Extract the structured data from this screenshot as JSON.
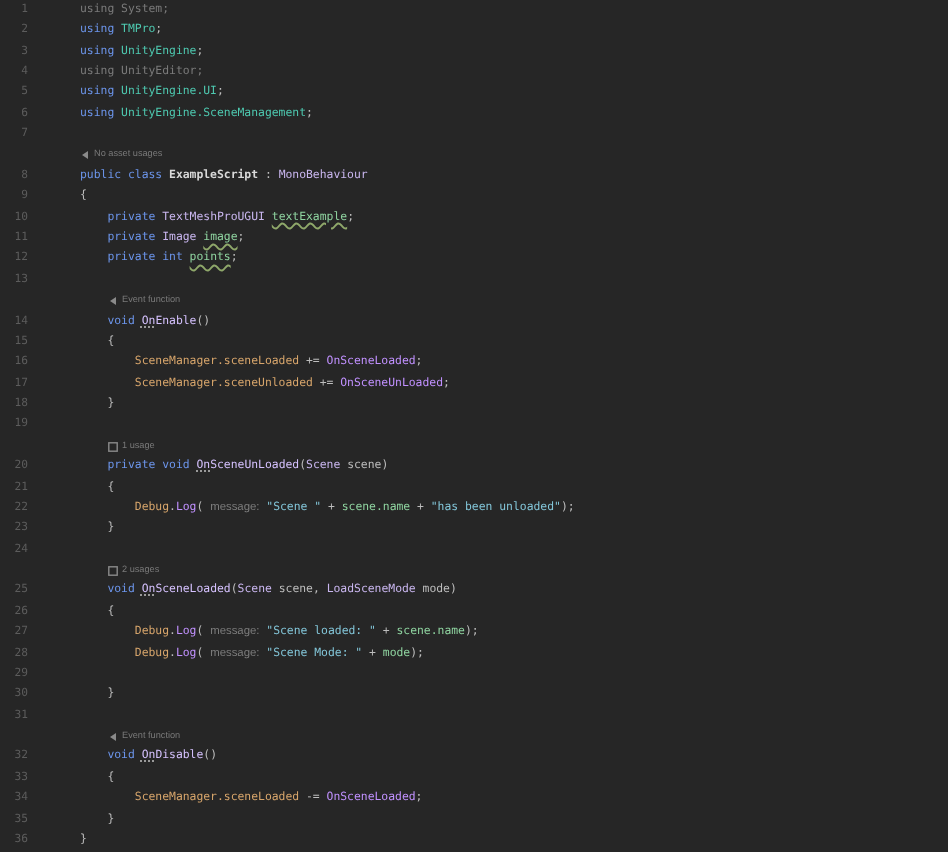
{
  "editor": {
    "lines": [
      {
        "kind": "code",
        "number": "1",
        "tokens": [
          {
            "text": "using System;",
            "kind": "dim"
          }
        ]
      },
      {
        "kind": "code",
        "number": "2",
        "tokens": [
          {
            "text": "using ",
            "kind": "kw"
          },
          {
            "text": "TMPro",
            "kind": "ns"
          },
          {
            "text": ";",
            "kind": "plain"
          }
        ]
      },
      {
        "kind": "code",
        "number": "3",
        "tokens": [
          {
            "text": "using ",
            "kind": "kw"
          },
          {
            "text": "UnityEngine",
            "kind": "ns"
          },
          {
            "text": ";",
            "kind": "plain"
          }
        ]
      },
      {
        "kind": "code",
        "number": "4",
        "tokens": [
          {
            "text": "using UnityEditor;",
            "kind": "dim"
          }
        ]
      },
      {
        "kind": "code",
        "number": "5",
        "tokens": [
          {
            "text": "using ",
            "kind": "kw"
          },
          {
            "text": "UnityEngine.UI",
            "kind": "ns"
          },
          {
            "text": ";",
            "kind": "plain"
          }
        ]
      },
      {
        "kind": "code",
        "number": "6",
        "tokens": [
          {
            "text": "using ",
            "kind": "kw"
          },
          {
            "text": "UnityEngine.SceneManagement",
            "kind": "ns"
          },
          {
            "text": ";",
            "kind": "plain"
          }
        ]
      },
      {
        "kind": "code",
        "number": "7"
      },
      {
        "kind": "event_hint",
        "indented": false,
        "text": "No asset usages"
      },
      {
        "kind": "code",
        "number": "8",
        "tokens": [
          {
            "text": "public class ",
            "kind": "kw"
          },
          {
            "text": "ExampleScript",
            "kind": "cls"
          },
          {
            "text": " : ",
            "kind": "plain"
          },
          {
            "text": "MonoBehaviour",
            "kind": "type"
          }
        ]
      },
      {
        "kind": "code",
        "number": "9",
        "tokens": [
          {
            "text": "{",
            "kind": "plain"
          }
        ]
      },
      {
        "kind": "code",
        "number": "10",
        "tokens": [
          {
            "text": "    private ",
            "kind": "kw"
          },
          {
            "text": "TextMeshProUGUI ",
            "kind": "type"
          },
          {
            "text": "textExample",
            "kind": "fieldwarn"
          },
          {
            "text": ";",
            "kind": "plain"
          }
        ]
      },
      {
        "kind": "code",
        "number": "11",
        "tokens": [
          {
            "text": "    private ",
            "kind": "kw"
          },
          {
            "text": "Image ",
            "kind": "type"
          },
          {
            "text": "image",
            "kind": "fieldwarn"
          },
          {
            "text": ";",
            "kind": "plain"
          }
        ]
      },
      {
        "kind": "code",
        "number": "12",
        "tokens": [
          {
            "text": "    private int ",
            "kind": "kw"
          },
          {
            "text": "points",
            "kind": "fieldwarn"
          },
          {
            "text": ";",
            "kind": "plain"
          }
        ]
      },
      {
        "kind": "code",
        "number": "13"
      },
      {
        "kind": "event_hint",
        "indented": true,
        "text": "Event function"
      },
      {
        "kind": "code",
        "number": "14",
        "tokens": [
          {
            "text": "    void ",
            "kind": "kw"
          },
          {
            "text": "On",
            "kind": "hintmark"
          },
          {
            "text": "Enable",
            "kind": "method"
          },
          {
            "text": "()",
            "kind": "plain"
          }
        ]
      },
      {
        "kind": "code",
        "number": "15",
        "tokens": [
          {
            "text": "    {",
            "kind": "plain"
          }
        ]
      },
      {
        "kind": "code",
        "number": "16",
        "tokens": [
          {
            "text": "        SceneManager.sceneLoaded",
            "kind": "static"
          },
          {
            "text": " += ",
            "kind": "plain"
          },
          {
            "text": "OnSceneLoaded",
            "kind": "ref"
          },
          {
            "text": ";",
            "kind": "plain"
          }
        ]
      },
      {
        "kind": "code",
        "number": "17",
        "tokens": [
          {
            "text": "        SceneManager.sceneUnloaded",
            "kind": "static"
          },
          {
            "text": " += ",
            "kind": "plain"
          },
          {
            "text": "OnSceneUnLoaded",
            "kind": "ref"
          },
          {
            "text": ";",
            "kind": "plain"
          }
        ]
      },
      {
        "kind": "code",
        "number": "18",
        "tokens": [
          {
            "text": "    }",
            "kind": "plain"
          }
        ]
      },
      {
        "kind": "code",
        "number": "19"
      },
      {
        "kind": "usage_hint",
        "indented": true,
        "text": "1 usage"
      },
      {
        "kind": "code",
        "number": "20",
        "tokens": [
          {
            "text": "    private void ",
            "kind": "kw"
          },
          {
            "text": "On",
            "kind": "hintmark"
          },
          {
            "text": "SceneUnLoaded",
            "kind": "method"
          },
          {
            "text": "(",
            "kind": "plain"
          },
          {
            "text": "Scene",
            "kind": "type"
          },
          {
            "text": " scene)",
            "kind": "plain"
          }
        ]
      },
      {
        "kind": "code",
        "number": "21",
        "tokens": [
          {
            "text": "    {",
            "kind": "plain"
          }
        ]
      },
      {
        "kind": "code",
        "number": "22",
        "tokens": [
          {
            "text": "        Debug",
            "kind": "static"
          },
          {
            "text": ".",
            "kind": "plain"
          },
          {
            "text": "Log",
            "kind": "ref"
          },
          {
            "text": "( ",
            "kind": "plain"
          },
          {
            "text": "message:",
            "kind": "param"
          },
          {
            "text": "\"Scene \"",
            "kind": "str"
          },
          {
            "text": " + ",
            "kind": "plain"
          },
          {
            "text": "scene.name",
            "kind": "local"
          },
          {
            "text": " + ",
            "kind": "plain"
          },
          {
            "text": "\"has been unloaded\"",
            "kind": "str"
          },
          {
            "text": ");",
            "kind": "plain"
          }
        ]
      },
      {
        "kind": "code",
        "number": "23",
        "tokens": [
          {
            "text": "    }",
            "kind": "plain"
          }
        ]
      },
      {
        "kind": "code",
        "number": "24"
      },
      {
        "kind": "usage_hint",
        "indented": true,
        "text": "2 usages"
      },
      {
        "kind": "code",
        "number": "25",
        "tokens": [
          {
            "text": "    void ",
            "kind": "kw"
          },
          {
            "text": "On",
            "kind": "hintmark"
          },
          {
            "text": "SceneLoaded",
            "kind": "method"
          },
          {
            "text": "(",
            "kind": "plain"
          },
          {
            "text": "Scene",
            "kind": "type"
          },
          {
            "text": " scene, ",
            "kind": "plain"
          },
          {
            "text": "LoadSceneMode",
            "kind": "type"
          },
          {
            "text": " mode)",
            "kind": "plain"
          }
        ]
      },
      {
        "kind": "code",
        "number": "26",
        "tokens": [
          {
            "text": "    {",
            "kind": "plain"
          }
        ]
      },
      {
        "kind": "code",
        "number": "27",
        "tokens": [
          {
            "text": "        Debug",
            "kind": "static"
          },
          {
            "text": ".",
            "kind": "plain"
          },
          {
            "text": "Log",
            "kind": "ref"
          },
          {
            "text": "( ",
            "kind": "plain"
          },
          {
            "text": "message:",
            "kind": "param"
          },
          {
            "text": "\"Scene loaded: \"",
            "kind": "str"
          },
          {
            "text": " + ",
            "kind": "plain"
          },
          {
            "text": "scene.name",
            "kind": "local"
          },
          {
            "text": ");",
            "kind": "plain"
          }
        ]
      },
      {
        "kind": "code",
        "number": "28",
        "tokens": [
          {
            "text": "        Debug",
            "kind": "static"
          },
          {
            "text": ".",
            "kind": "plain"
          },
          {
            "text": "Log",
            "kind": "ref"
          },
          {
            "text": "( ",
            "kind": "plain"
          },
          {
            "text": "message:",
            "kind": "param"
          },
          {
            "text": "\"Scene Mode: \"",
            "kind": "str"
          },
          {
            "text": " + ",
            "kind": "plain"
          },
          {
            "text": "mode",
            "kind": "local"
          },
          {
            "text": ");",
            "kind": "plain"
          }
        ]
      },
      {
        "kind": "code",
        "number": "29"
      },
      {
        "kind": "code",
        "number": "30",
        "tokens": [
          {
            "text": "    }",
            "kind": "plain"
          }
        ]
      },
      {
        "kind": "code",
        "number": "31"
      },
      {
        "kind": "event_hint",
        "indented": true,
        "text": "Event function"
      },
      {
        "kind": "code",
        "number": "32",
        "tokens": [
          {
            "text": "    void ",
            "kind": "kw"
          },
          {
            "text": "On",
            "kind": "hintmark"
          },
          {
            "text": "Disable",
            "kind": "method"
          },
          {
            "text": "()",
            "kind": "plain"
          }
        ]
      },
      {
        "kind": "code",
        "number": "33",
        "tokens": [
          {
            "text": "    {",
            "kind": "plain"
          }
        ]
      },
      {
        "kind": "code",
        "number": "34",
        "tokens": [
          {
            "text": "        SceneManager.sceneLoaded",
            "kind": "static"
          },
          {
            "text": " -= ",
            "kind": "plain"
          },
          {
            "text": "OnSceneLoaded",
            "kind": "ref"
          },
          {
            "text": ";",
            "kind": "plain"
          }
        ]
      },
      {
        "kind": "code",
        "number": "35",
        "tokens": [
          {
            "text": "    }",
            "kind": "plain"
          }
        ]
      },
      {
        "kind": "code",
        "number": "36",
        "tokens": [
          {
            "text": "}",
            "kind": "plain"
          }
        ]
      }
    ]
  }
}
